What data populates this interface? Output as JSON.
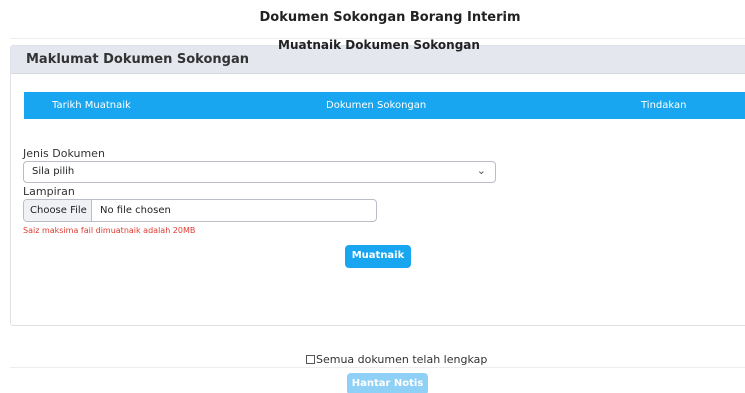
{
  "page": {
    "title": "Dokumen Sokongan Borang Interim"
  },
  "card": {
    "header": "Maklumat Dokumen Sokongan",
    "subtitle": "Muatnaik Dokumen Sokongan",
    "table": {
      "columns": [
        "Tarikh Muatnaik",
        "Dokumen Sokongan",
        "Tindakan"
      ],
      "rows": []
    },
    "form": {
      "jenis_label": "Jenis Dokumen",
      "jenis_selected": "Sila pilih",
      "lampiran_label": "Lampiran",
      "file_button": "Choose File",
      "file_status": "No file chosen",
      "hint": "Saiz maksima fail dimuatnaik adalah 20MB",
      "upload_button": "Muatnaik"
    }
  },
  "footer": {
    "checkbox_label": "Semua dokumen telah lengkap",
    "checkbox_checked": false,
    "submit_button": "Hantar Notis",
    "submit_enabled": false
  },
  "colors": {
    "accent": "#18a6f0",
    "accent_disabled": "#8fd0f6",
    "header_bg": "#e4e7ee",
    "error": "#e03a2f"
  },
  "icons": {
    "select_arrow": "chevron-down-icon"
  }
}
